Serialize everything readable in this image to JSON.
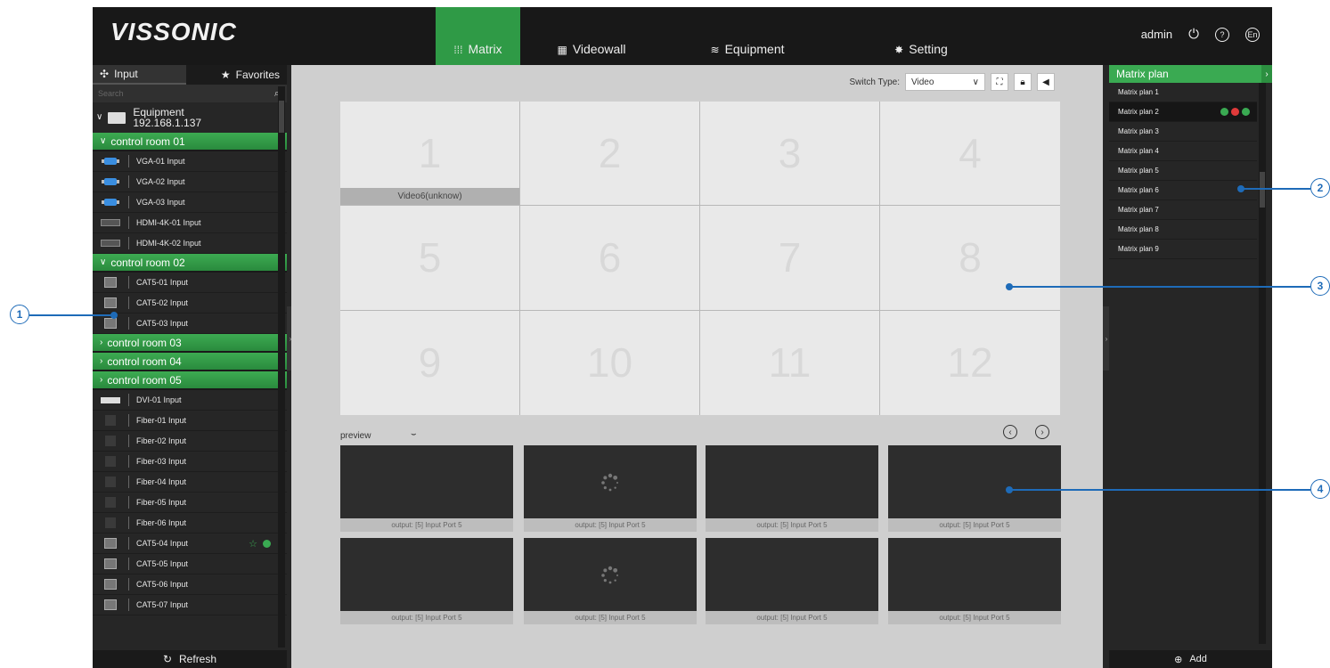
{
  "header": {
    "logo": "VISSONIC",
    "nav": [
      {
        "icon": "matrix-icon",
        "glyph": "⁞⁞⁞",
        "label": "Matrix",
        "active": true
      },
      {
        "icon": "videowall-icon",
        "glyph": "▦",
        "label": "Videowall",
        "active": false
      },
      {
        "icon": "equipment-icon",
        "glyph": "≋",
        "label": "Equipment",
        "active": false
      },
      {
        "icon": "gear-icon",
        "glyph": "✸",
        "label": "Setting",
        "active": false
      }
    ],
    "user": "admin",
    "lang": "En",
    "help": "?"
  },
  "left": {
    "tab_input": "Input",
    "tab_favorites": "Favorites",
    "search_placeholder": "Search",
    "equipment_name": "Equipment",
    "equipment_ip": "192.168.1.137",
    "groups": [
      {
        "label": "control room 01",
        "open": true,
        "items": [
          "VGA-01 Input",
          "VGA-02 Input",
          "VGA-03 Input",
          "HDMI-4K-01 Input",
          "HDMI-4K-02 Input"
        ]
      },
      {
        "label": "control room 02",
        "open": true,
        "items": [
          "CAT5-01 Input",
          "CAT5-02 Input",
          "CAT5-03 Input"
        ]
      },
      {
        "label": "control room 03",
        "open": false,
        "items": []
      },
      {
        "label": "control room 04",
        "open": false,
        "items": []
      },
      {
        "label": "control room 05",
        "open": false,
        "items": []
      }
    ],
    "loose_items": [
      "DVI-01 Input",
      "Fiber-01 Input",
      "Fiber-02 Input",
      "Fiber-03 Input",
      "Fiber-04 Input",
      "Fiber-05 Input",
      "Fiber-06 Input",
      "CAT5-04 Input",
      "CAT5-05 Input",
      "CAT5-06 Input",
      "CAT5-07 Input"
    ],
    "refresh_label": "Refresh"
  },
  "center": {
    "switch_type_label": "Switch Type:",
    "switch_type_value": "Video",
    "grid_cells": [
      "1",
      "2",
      "3",
      "4",
      "5",
      "6",
      "7",
      "8",
      "9",
      "10",
      "11",
      "12"
    ],
    "cell1_source": "Video6(unknow)",
    "preview_label": "preview",
    "preview_caption": "output:  [5] Input Port 5"
  },
  "right": {
    "title": "Matrix plan",
    "plans": [
      "Matrix plan 1",
      "Matrix plan 2",
      "Matrix plan 3",
      "Matrix plan 4",
      "Matrix plan 5",
      "Matrix plan 6",
      "Matrix plan 7",
      "Matrix plan 8",
      "Matrix plan 9"
    ],
    "selected_index": 1,
    "add_label": "Add"
  },
  "callouts": [
    "1",
    "2",
    "3",
    "4"
  ],
  "colors": {
    "accent_green": "#3aaa52",
    "callout_blue": "#1e6bb8"
  }
}
